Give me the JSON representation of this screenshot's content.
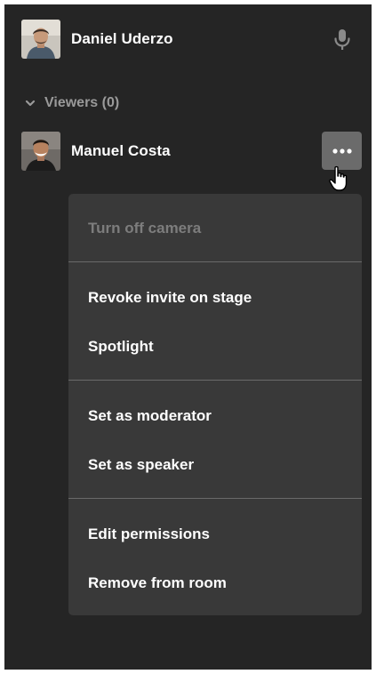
{
  "stage": {
    "speaker": {
      "name": "Daniel Uderzo",
      "icon": "microphone-icon"
    }
  },
  "viewers": {
    "header_label": "Viewers (0)",
    "items": [
      {
        "name": "Manuel Costa",
        "more_icon": "more-horizontal-icon"
      }
    ]
  },
  "context_menu": {
    "items": [
      {
        "label": "Turn off camera",
        "disabled": true
      },
      {
        "label": "Revoke invite on stage"
      },
      {
        "label": "Spotlight"
      },
      {
        "label": "Set as moderator"
      },
      {
        "label": "Set as speaker"
      },
      {
        "label": "Edit permissions"
      },
      {
        "label": "Remove from room"
      }
    ]
  },
  "colors": {
    "panel_background": "#252525",
    "menu_background": "#393939",
    "button_background": "#6b6b6b",
    "text_primary": "#ffffff",
    "text_muted": "#9a9a9a",
    "text_disabled": "#7d7d7d"
  }
}
